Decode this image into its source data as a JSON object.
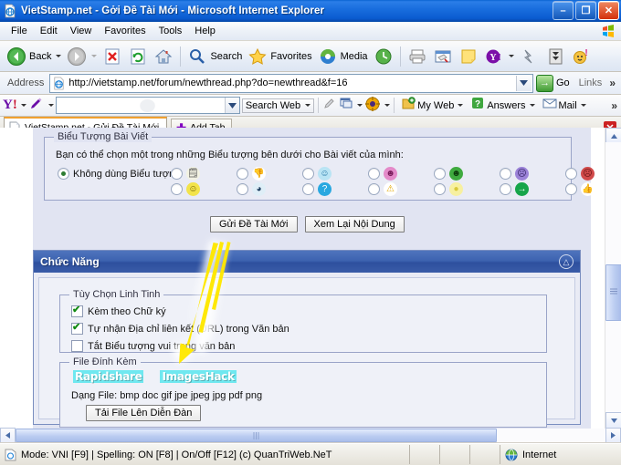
{
  "window": {
    "title": "VietStamp.net - Gởi Đề Tài Mới - Microsoft Internet Explorer",
    "icon": "ie-page-icon",
    "minimize": "–",
    "maximize": "❐",
    "close": "✕"
  },
  "menubar": {
    "items": [
      "File",
      "Edit",
      "View",
      "Favorites",
      "Tools",
      "Help"
    ],
    "flag_icon": "windows-flag-icon"
  },
  "toolbar": {
    "back_label": "Back",
    "forward_label": "",
    "stop_label": "",
    "refresh_label": "",
    "home_label": "",
    "search_label": "Search",
    "favorites_label": "Favorites",
    "media_label": "Media",
    "history_label": "",
    "print_label": "",
    "edit_label": "",
    "notes_label": "",
    "yahoo_label": "",
    "messenger_label": "",
    "download_label": "",
    "smiley_label": ""
  },
  "address": {
    "label": "Address",
    "url": "http://vietstamp.net/forum/newthread.php?do=newthread&f=16",
    "go_label": "Go",
    "links_label": "Links",
    "chevron": "»",
    "dropdown": "⌄"
  },
  "yahoo_bar": {
    "logo": "Y",
    "logo_bang": "!",
    "search_value": "",
    "search_web_label": "Search Web",
    "my_web_label": "My Web",
    "answers_label": "Answers",
    "mail_label": "Mail",
    "chevron": "»"
  },
  "tabs": {
    "active": "VietStamp.net - Gửi Đề Tài Mới",
    "add_tab_label": "Add Tab",
    "close_label": "✕"
  },
  "forum": {
    "icon_section": {
      "legend": "Biểu Tượng Bài Viết",
      "description": "Bạn có thể chọn một trong những Biểu tượng bên dưới cho Bài viết của mình:",
      "no_icon_label": "Không dùng Biểu tượng",
      "no_icon_selected": true,
      "icons_row1": [
        {
          "name": "document-icon",
          "glyph": "🗒",
          "bg": "#f2f2e2",
          "fg": "#555555"
        },
        {
          "name": "thumbs-down-icon",
          "glyph": "👎",
          "bg": "#ffffff",
          "fg": "#d44a4a"
        },
        {
          "name": "smiley-cool-blue-icon",
          "glyph": "☺",
          "bg": "#b9e4f4",
          "fg": "#1a6ea0"
        },
        {
          "name": "smiley-pink-icon",
          "glyph": "☻",
          "bg": "#e48ac9",
          "fg": "#7a1c5c"
        },
        {
          "name": "smiley-green-grin-icon",
          "glyph": "☻",
          "bg": "#3faa3f",
          "fg": "#0d3c0d"
        },
        {
          "name": "smiley-purple-confused-icon",
          "glyph": "☹",
          "bg": "#9b82d8",
          "fg": "#31205e"
        },
        {
          "name": "smiley-red-angry-icon",
          "glyph": "☹",
          "bg": "#d14a4a",
          "fg": "#5e1212"
        }
      ],
      "icons_row2": [
        {
          "name": "smiley-yellow-icon",
          "glyph": "☺",
          "bg": "#f2e34a",
          "fg": "#6b5a00"
        },
        {
          "name": "smiley-sunglasses-icon",
          "glyph": "◕",
          "bg": "#dfeef7",
          "fg": "#1b3c5e"
        },
        {
          "name": "smiley-question-icon",
          "glyph": "?",
          "bg": "#29a8e0",
          "fg": "#ffffff"
        },
        {
          "name": "warning-triangle-icon",
          "glyph": "⚠",
          "bg": "#ffffff",
          "fg": "#e3a800"
        },
        {
          "name": "lightbulb-icon",
          "glyph": "●",
          "bg": "#f7f0a0",
          "fg": "#d9c93a"
        },
        {
          "name": "arrow-right-green-icon",
          "glyph": "→",
          "bg": "#17a54a",
          "fg": "#ffffff"
        },
        {
          "name": "thumbs-up-icon",
          "glyph": "👍",
          "bg": "#ffffff",
          "fg": "#d9a72a"
        }
      ]
    },
    "submit_button": "Gửi Đề Tài Mới",
    "preview_button": "Xem Lại Nội Dung",
    "functions_panel": {
      "title": "Chức Năng",
      "collapse_icon": "collapse-icon",
      "options_legend": "Tùy Chọn Linh Tinh",
      "options": [
        {
          "label": "Kèm theo Chữ ký",
          "checked": true
        },
        {
          "label": "Tự nhận Địa chỉ liên kết (URL) trong Văn bản",
          "checked": true
        },
        {
          "label": "Tắt Biểu tượng vui trong văn bản",
          "checked": false
        }
      ],
      "attach_legend": "File Đính Kèm",
      "links": [
        {
          "label": "Rapidshare",
          "name": "rapidshare-link"
        },
        {
          "label": "ImagesHack",
          "name": "imageshack-link"
        }
      ],
      "filetypes_label": "Dạng File: bmp doc gif jpe jpeg jpg pdf png",
      "upload_button": "Tải File Lên Diễn Đàn"
    }
  },
  "scrollbars": {
    "up": "▲",
    "down": "▼",
    "left": "◄",
    "right": "►",
    "grip": "‖"
  },
  "statusbar": {
    "message": "Mode: VNI [F9] | Spelling: ON [F8] | On/Off [F12] (c) QuanTriWeb.NeT",
    "zone": "Internet",
    "zone_icon": "globe-icon",
    "page_icon": "ie-page-icon"
  },
  "annotation": {
    "arrow_color": "#FFE800",
    "glow_color": "#ffffff",
    "name": "yellow-pointer-arrow"
  }
}
